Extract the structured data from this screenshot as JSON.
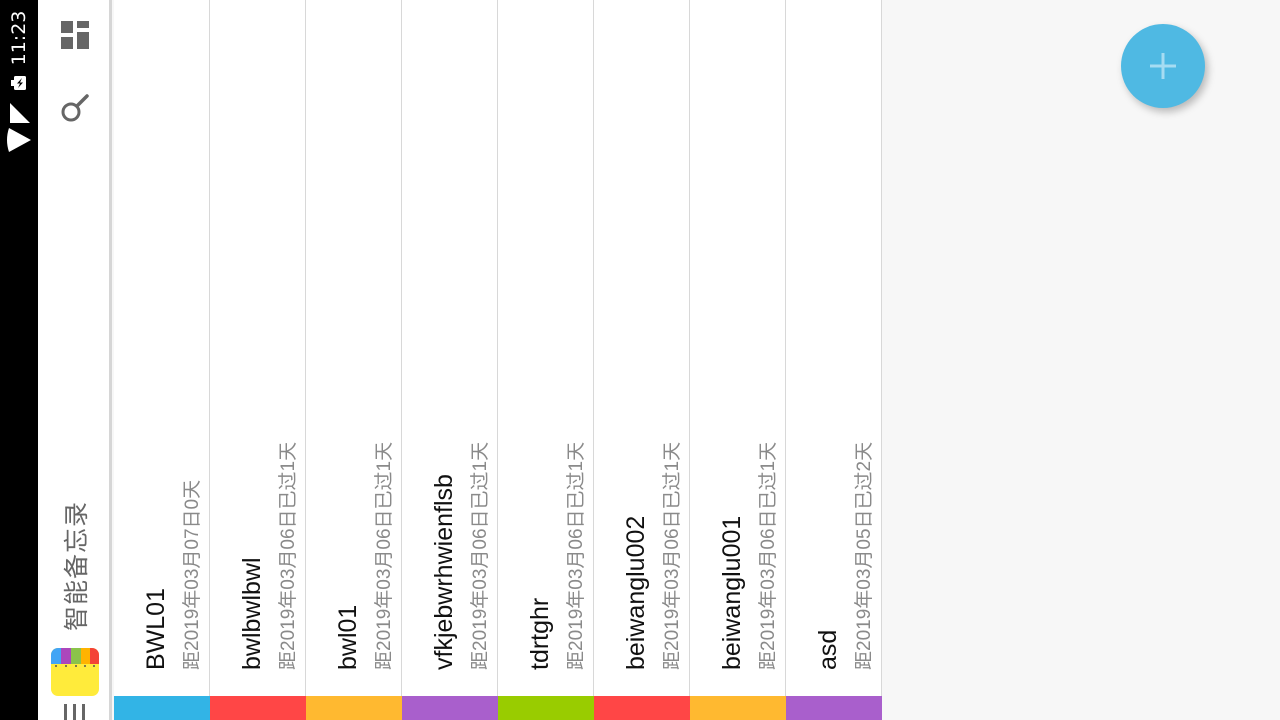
{
  "status_bar": {
    "time": "11:23",
    "icons": [
      "battery-charging-icon",
      "signal-icon",
      "wifi-icon"
    ]
  },
  "app_bar": {
    "title": "智能备忘录",
    "icons": [
      "dashboard-grid-icon",
      "search-icon",
      "app-logo-icon",
      "menu-icon"
    ]
  },
  "memos": [
    {
      "title": "BWL01",
      "subtitle": "距2019年03月07日0天",
      "color": "#32b4e6"
    },
    {
      "title": "bwlbwlbwl",
      "subtitle": "距2019年03月06日已过1天",
      "color": "#ff4646"
    },
    {
      "title": "bwl01",
      "subtitle": "距2019年03月06日已过1天",
      "color": "#ffb930"
    },
    {
      "title": "vfkjebwrhwienflsb",
      "subtitle": "距2019年03月06日已过1天",
      "color": "#a95fcc"
    },
    {
      "title": "tdrtghr",
      "subtitle": "距2019年03月06日已过1天",
      "color": "#99cc00"
    },
    {
      "title": "beiwanglu002",
      "subtitle": "距2019年03月06日已过1天",
      "color": "#ff4646"
    },
    {
      "title": "beiwanglu001",
      "subtitle": "距2019年03月06日已过1天",
      "color": "#ffb930"
    },
    {
      "title": "asd",
      "subtitle": "距2019年03月05日已过2天",
      "color": "#a95fcc"
    }
  ],
  "fab": {
    "icon": "plus-icon",
    "color": "#4fb9e3"
  },
  "colors": {
    "status_bar": "#000000",
    "app_bar": "#ffffff",
    "background": "#f7f7f7"
  }
}
